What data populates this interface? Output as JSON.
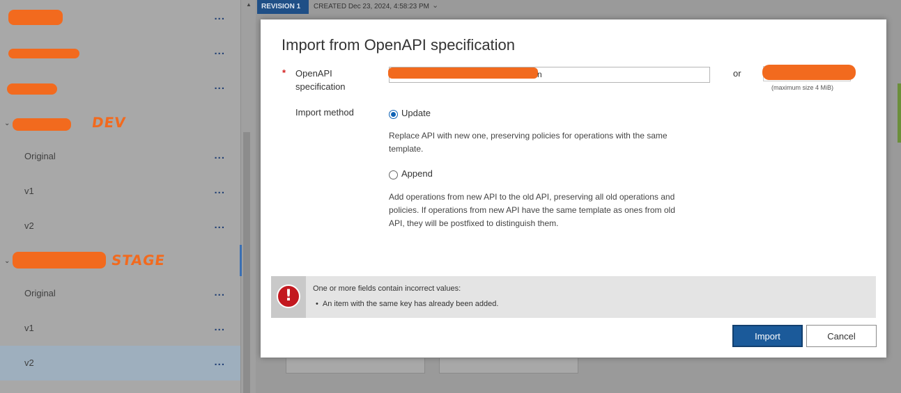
{
  "sidebar": {
    "items": [
      {
        "label": "",
        "more": "..."
      },
      {
        "label": "",
        "more": "..."
      },
      {
        "label": "",
        "more": "..."
      },
      {
        "label": "Original",
        "more": "..."
      },
      {
        "label": "v1",
        "more": "..."
      },
      {
        "label": "v2",
        "more": "..."
      },
      {
        "label": "Original",
        "more": "..."
      },
      {
        "label": "v1",
        "more": "..."
      },
      {
        "label": "v2",
        "more": "...",
        "selected": true
      }
    ],
    "group_tags": {
      "dev": "DEV",
      "stage": "STAGE"
    },
    "redaction_color": "#f26a1e"
  },
  "revision": {
    "tab": "REVISION 1",
    "created": "CREATED Dec 23, 2024, 4:58:23 PM"
  },
  "dialog": {
    "title": "Import from OpenAPI specification",
    "spec_label_line1": "OpenAPI",
    "spec_label_line2": "specification",
    "spec_value_tail": "n",
    "or": "or",
    "max_size": "(maximum size 4 MiB)",
    "import_method_label": "Import method",
    "options": {
      "update": {
        "label": "Update",
        "desc_line1": "Replace API with new one, preserving policies for operations with the same",
        "desc_line2": "template.",
        "checked": true
      },
      "append": {
        "label": "Append",
        "desc_line1": "Add operations from new API to the old API, preserving all old operations and",
        "desc_line2": "policies. If operations from new API have the same template as ones from old",
        "desc_line3": "API, they will be postfixed to distinguish them.",
        "checked": false
      }
    },
    "error": {
      "icon": "!",
      "title": "One or more fields contain incorrect values:",
      "items": [
        "An item with the same key has already been added."
      ]
    },
    "buttons": {
      "import": "Import",
      "cancel": "Cancel"
    },
    "colors": {
      "primary": "#1b5a9a",
      "error": "#c3181f",
      "required": "#d32020"
    }
  }
}
